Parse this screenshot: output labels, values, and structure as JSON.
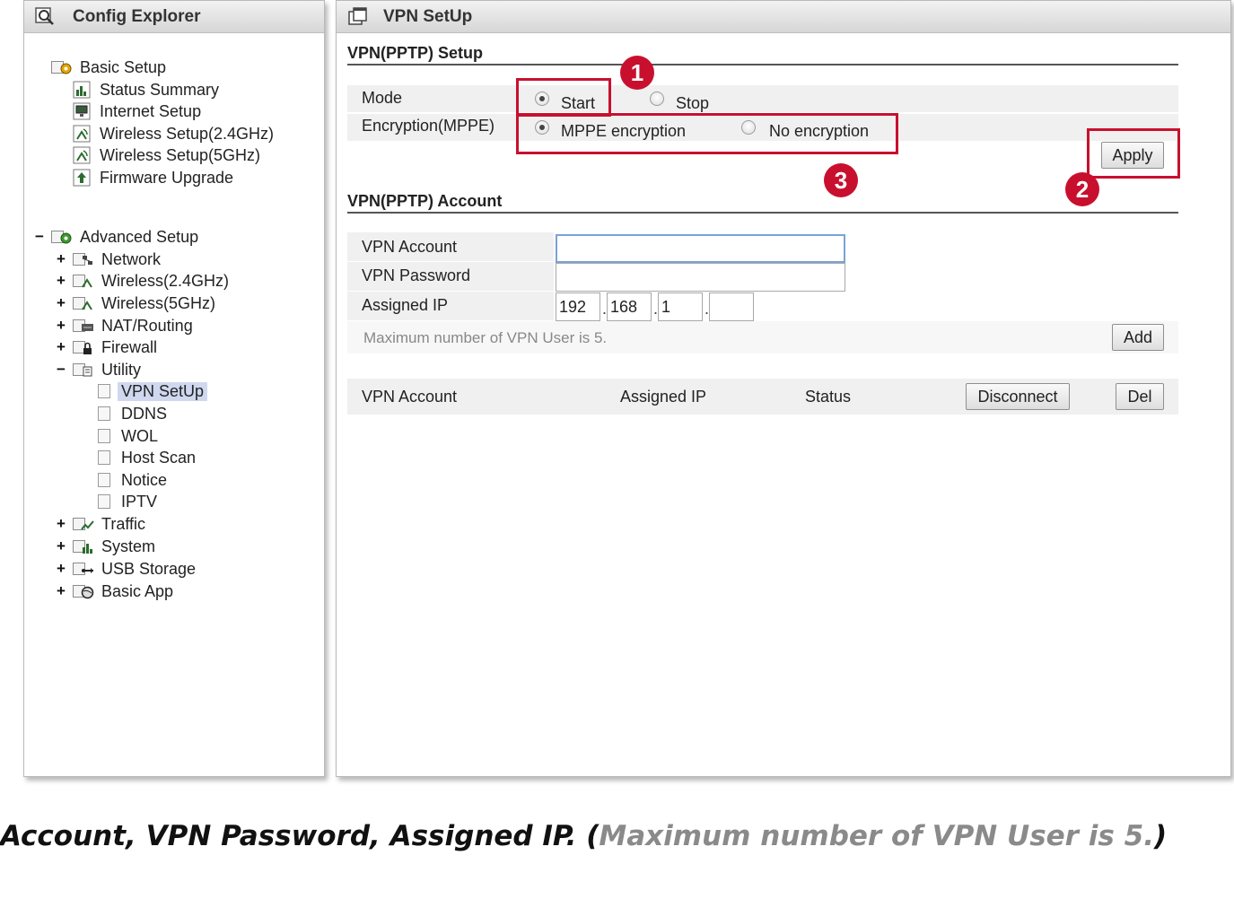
{
  "left_panel": {
    "title": "Config Explorer",
    "basic_setup": {
      "label": "Basic Setup",
      "items": [
        {
          "label": "Status Summary",
          "icon": "chart-icon"
        },
        {
          "label": "Internet Setup",
          "icon": "monitor-icon"
        },
        {
          "label": "Wireless Setup(2.4GHz)",
          "icon": "wireless-icon"
        },
        {
          "label": "Wireless Setup(5GHz)",
          "icon": "wireless-icon"
        },
        {
          "label": "Firmware Upgrade",
          "icon": "upgrade-icon"
        }
      ]
    },
    "advanced_setup": {
      "expander": "−",
      "label": "Advanced Setup",
      "items": [
        {
          "expander": "+",
          "label": "Network"
        },
        {
          "expander": "+",
          "label": "Wireless(2.4GHz)"
        },
        {
          "expander": "+",
          "label": "Wireless(5GHz)"
        },
        {
          "expander": "+",
          "label": "NAT/Routing"
        },
        {
          "expander": "+",
          "label": "Firewall"
        },
        {
          "expander": "−",
          "label": "Utility"
        }
      ],
      "utility_children": [
        "VPN SetUp",
        "DDNS",
        "WOL",
        "Host Scan",
        "Notice",
        "IPTV"
      ],
      "more_items": [
        {
          "expander": "+",
          "label": "Traffic"
        },
        {
          "expander": "+",
          "label": "System"
        },
        {
          "expander": "+",
          "label": "USB Storage"
        },
        {
          "expander": "+",
          "label": "Basic App"
        }
      ]
    }
  },
  "right_panel": {
    "title": "VPN SetUp",
    "setup_section": {
      "title": "VPN(PPTP) Setup",
      "mode_label": "Mode",
      "mode_options": {
        "start": "Start",
        "stop": "Stop"
      },
      "mode_selected": "Start",
      "encryption_label": "Encryption(MPPE)",
      "encryption_options": {
        "mppe": "MPPE encryption",
        "none": "No encryption"
      },
      "encryption_selected": "MPPE encryption",
      "apply_label": "Apply"
    },
    "account_section": {
      "title": "VPN(PPTP) Account",
      "account_label": "VPN Account",
      "account_value": "",
      "password_label": "VPN Password",
      "password_value": "",
      "ip_label": "Assigned IP",
      "ip_octets": [
        "192",
        "168",
        "1",
        ""
      ],
      "hint": "Maximum number of VPN User is 5.",
      "add_label": "Add"
    },
    "table": {
      "headers": [
        "VPN Account",
        "Assigned IP",
        "Status"
      ],
      "disconnect_label": "Disconnect",
      "del_label": "Del"
    }
  },
  "annotations": {
    "one": "1",
    "two": "2",
    "three": "3",
    "color": "#c8102e"
  },
  "caption": {
    "main": "Account, VPN Password, Assigned IP. (",
    "muted": "Maximum number of VPN User is 5.",
    "close": ")"
  }
}
